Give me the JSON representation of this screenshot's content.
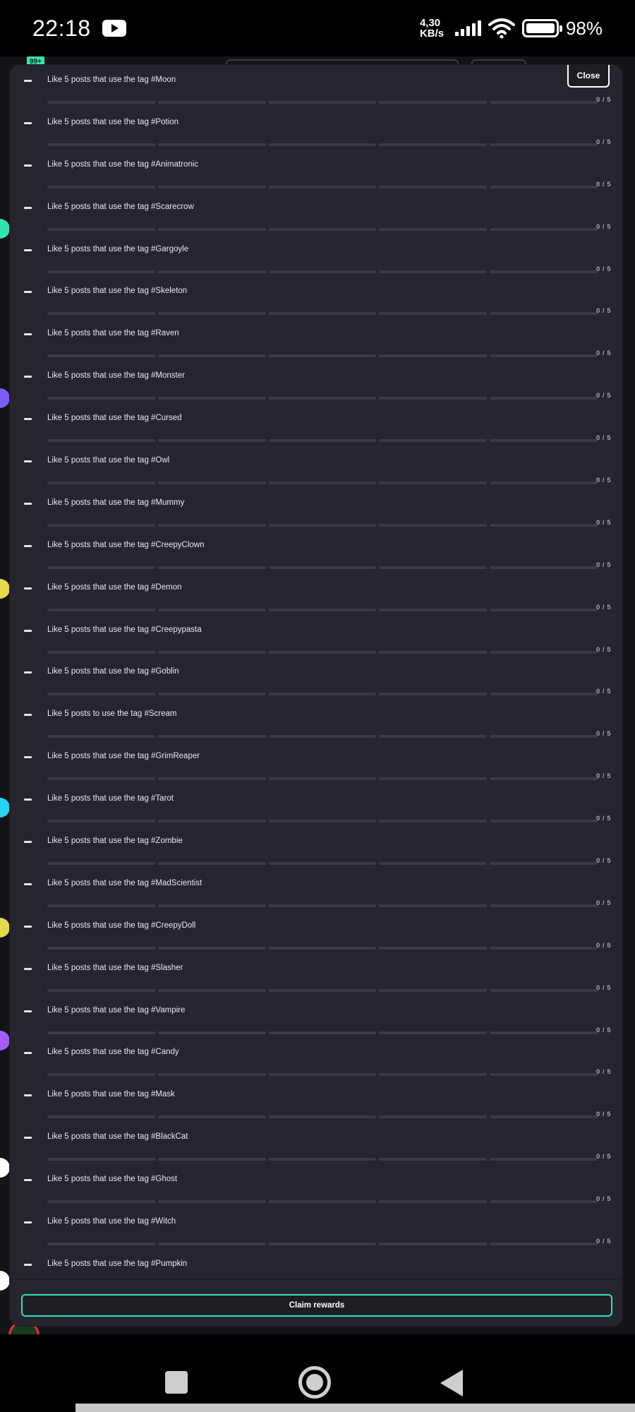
{
  "status_bar": {
    "time": "22:18",
    "network_speed": "4,30",
    "network_speed_unit": "KB/s",
    "battery_percent": "98%",
    "icons": [
      "youtube-icon",
      "signal-icon",
      "wifi-icon",
      "battery-icon"
    ]
  },
  "background": {
    "notification_badge": "99+"
  },
  "modal": {
    "close_label": "Close",
    "tasks": [
      {
        "label": "Like 5 posts that use the tag #Moon",
        "progress": "0 / 5"
      },
      {
        "label": "Like 5 posts that use the tag #Potion",
        "progress": "0 / 5"
      },
      {
        "label": "Like 5 posts that use the tag #Animatronic",
        "progress": "0 / 5"
      },
      {
        "label": "Like 5 posts that use the tag #Scarecrow",
        "progress": "0 / 5"
      },
      {
        "label": "Like 5 posts that use the tag #Gargoyle",
        "progress": "0 / 5"
      },
      {
        "label": "Like 5 posts that use the tag #Skeleton",
        "progress": "0 / 5"
      },
      {
        "label": "Like 5 posts that use the tag #Raven",
        "progress": "0 / 5"
      },
      {
        "label": "Like 5 posts that use the tag #Monster",
        "progress": "0 / 5"
      },
      {
        "label": "Like 5 posts that use the tag #Cursed",
        "progress": "0 / 5"
      },
      {
        "label": "Like 5 posts that use the tag #Owl",
        "progress": "0 / 5"
      },
      {
        "label": "Like 5 posts that use the tag #Mummy",
        "progress": "0 / 5"
      },
      {
        "label": "Like 5 posts that use the tag #CreepyClown",
        "progress": "0 / 5"
      },
      {
        "label": "Like 5 posts that use the tag #Demon",
        "progress": "0 / 5"
      },
      {
        "label": "Like 5 posts that use the tag #Creepypasta",
        "progress": "0 / 5"
      },
      {
        "label": "Like 5 posts that use the tag #Goblin",
        "progress": "0 / 5"
      },
      {
        "label": "Like 5 posts to use the tag #Scream",
        "progress": "0 / 5"
      },
      {
        "label": "Like 5 posts that use the tag #GrimReaper",
        "progress": "0 / 5"
      },
      {
        "label": "Like 5 posts that use the tag #Tarot",
        "progress": "0 / 5"
      },
      {
        "label": "Like 5 posts that use the tag #Zombie",
        "progress": "0 / 5"
      },
      {
        "label": "Like 5 posts that use the tag #MadScientist",
        "progress": "0 / 5"
      },
      {
        "label": "Like 5 posts that use the tag #CreepyDoll",
        "progress": "0 / 5"
      },
      {
        "label": "Like 5 posts that use the tag #Slasher",
        "progress": "0 / 5"
      },
      {
        "label": "Like 5 posts that use the tag #Vampire",
        "progress": "0 / 5"
      },
      {
        "label": "Like 5 posts that use the tag #Candy",
        "progress": "0 / 5"
      },
      {
        "label": "Like 5 posts that use the tag #Mask",
        "progress": "0 / 5"
      },
      {
        "label": "Like 5 posts that use the tag #BlackCat",
        "progress": "0 / 5"
      },
      {
        "label": "Like 5 posts that use the tag #Ghost",
        "progress": "0 / 5"
      },
      {
        "label": "Like 5 posts that use the tag #Witch",
        "progress": "0 / 5"
      },
      {
        "label": "Like 5 posts that use the tag #Pumpkin",
        "progress": ""
      }
    ],
    "claim_label": "Claim rewards"
  },
  "colors": {
    "accent": "#35e3b0",
    "modal_bg": "#26252d",
    "progress_track": "#3b3a43"
  },
  "navigation": {
    "icons": [
      "recents-square-icon",
      "home-circle-icon",
      "back-triangle-icon"
    ]
  }
}
